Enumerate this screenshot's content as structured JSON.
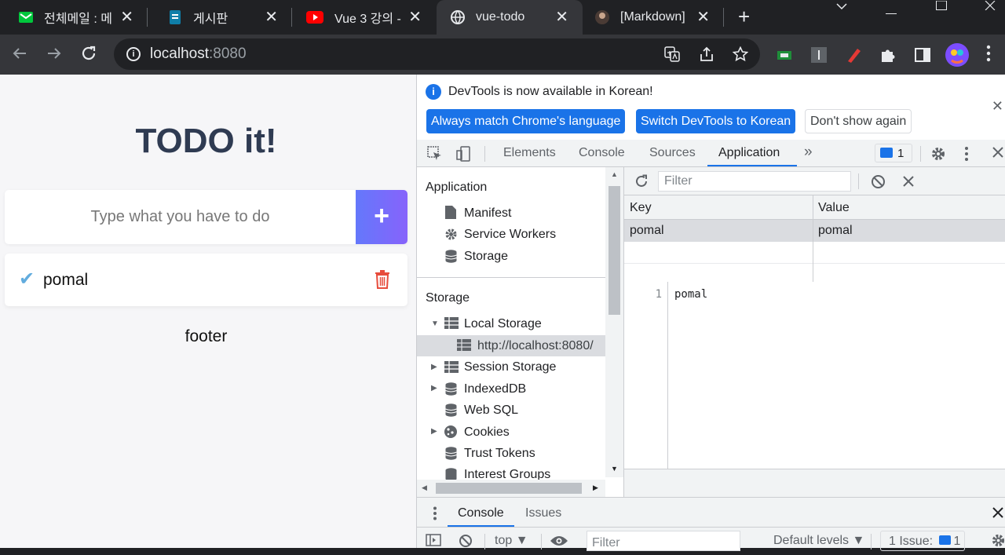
{
  "browser": {
    "tabs": [
      {
        "label": "전체메일 : 메",
        "icon": "mail-icon",
        "color": "#00c73c"
      },
      {
        "label": "게시판",
        "icon": "doc-icon",
        "color": "#0f7ea8"
      },
      {
        "label": "Vue 3 강의 -",
        "icon": "youtube-icon",
        "color": "#ff0000"
      },
      {
        "label": "vue-todo",
        "icon": "globe-icon",
        "active": true
      },
      {
        "label": "[Markdown]",
        "icon": "avatar-icon"
      }
    ],
    "url_host": "localhost",
    "url_port": ":8080"
  },
  "app": {
    "title": "TODO it!",
    "input_placeholder": "Type what you have to do",
    "add_label": "+",
    "todos": [
      {
        "text": "pomal",
        "completed": true
      }
    ],
    "footer": "footer",
    "accent": "#62acde"
  },
  "devtools": {
    "infobar": {
      "message": "DevTools is now available in Korean!",
      "btn_match": "Always match Chrome's language",
      "btn_switch": "Switch DevTools to Korean",
      "btn_dont": "Don't show again"
    },
    "tabs": {
      "elements": "Elements",
      "console": "Console",
      "sources": "Sources",
      "application": "Application",
      "more": "»"
    },
    "issues_count": "1",
    "sidebar": {
      "app_section": "Application",
      "manifest": "Manifest",
      "service_workers": "Service Workers",
      "storage_item": "Storage",
      "storage_section": "Storage",
      "local_storage": "Local Storage",
      "origin": "http://localhost:8080/",
      "session_storage": "Session Storage",
      "indexeddb": "IndexedDB",
      "websql": "Web SQL",
      "cookies": "Cookies",
      "trust_tokens": "Trust Tokens",
      "interest_groups": "Interest Groups"
    },
    "storage": {
      "filter_placeholder": "Filter",
      "col_key": "Key",
      "col_value": "Value",
      "rows": [
        {
          "key": "pomal",
          "value": "pomal"
        }
      ],
      "preview_line": "1",
      "preview_code": "pomal"
    },
    "drawer": {
      "tab_console": "Console",
      "tab_issues": "Issues",
      "context": "top",
      "filter_placeholder": "Filter",
      "levels": "Default levels ▼",
      "issues_label": "1 Issue:",
      "issues_count": "1"
    }
  }
}
